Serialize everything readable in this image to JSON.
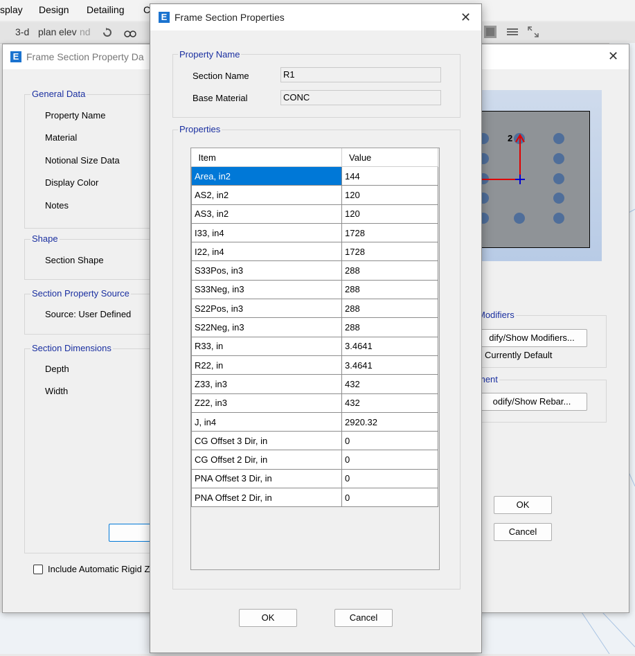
{
  "app": {
    "menu": [
      "splay",
      "Design",
      "Detailing",
      "C"
    ],
    "toolbar_text": [
      "3-d",
      "plan",
      "elev",
      "nd"
    ]
  },
  "back_dialog": {
    "title": "Frame Section Property Da",
    "general_data": {
      "label": "General Data",
      "items": [
        "Property Name",
        "Material",
        "Notional Size Data",
        "Display Color",
        "Notes"
      ]
    },
    "shape": {
      "label": "Shape",
      "item": "Section Shape"
    },
    "source": {
      "label": "Section Property Source",
      "item": "Source:  User Defined"
    },
    "dimensions": {
      "label": "Section Dimensions",
      "items": [
        "Depth",
        "Width"
      ]
    },
    "include_rigid": "Include Automatic Rigid Z",
    "preview_label": "2",
    "modifiers": {
      "label": "Modifiers",
      "button": "dify/Show Modifiers...",
      "status": "Currently Default"
    },
    "reinforcement": {
      "label": "ment",
      "button": "odify/Show Rebar..."
    },
    "ok": "OK",
    "cancel": "Cancel"
  },
  "dialog": {
    "title": "Frame Section Properties",
    "property_name_group": "Property Name",
    "section_name_label": "Section Name",
    "section_name_value": "R1",
    "base_material_label": "Base Material",
    "base_material_value": "CONC",
    "properties_group": "Properties",
    "table": {
      "headers": [
        "Item",
        "Value"
      ],
      "rows": [
        [
          "Area, in2",
          "144"
        ],
        [
          "AS2, in2",
          "120"
        ],
        [
          "AS3, in2",
          "120"
        ],
        [
          "I33, in4",
          "1728"
        ],
        [
          "I22, in4",
          "1728"
        ],
        [
          "S33Pos, in3",
          "288"
        ],
        [
          "S33Neg, in3",
          "288"
        ],
        [
          "S22Pos, in3",
          "288"
        ],
        [
          "S22Neg, in3",
          "288"
        ],
        [
          "R33, in",
          "3.4641"
        ],
        [
          "R22, in",
          "3.4641"
        ],
        [
          "Z33, in3",
          "432"
        ],
        [
          "Z22, in3",
          "432"
        ],
        [
          "J, in4",
          "2920.32"
        ],
        [
          "CG Offset 3 Dir, in",
          "0"
        ],
        [
          "CG Offset 2 Dir, in",
          "0"
        ],
        [
          "PNA Offset 3 Dir, in",
          "0"
        ],
        [
          "PNA Offset 2 Dir, in",
          "0"
        ]
      ],
      "selected_row": 0
    },
    "ok": "OK",
    "cancel": "Cancel"
  },
  "colors": {
    "accent": "#0078d7",
    "group_label": "#1a2fa0",
    "app_icon": "#1b73cf"
  }
}
